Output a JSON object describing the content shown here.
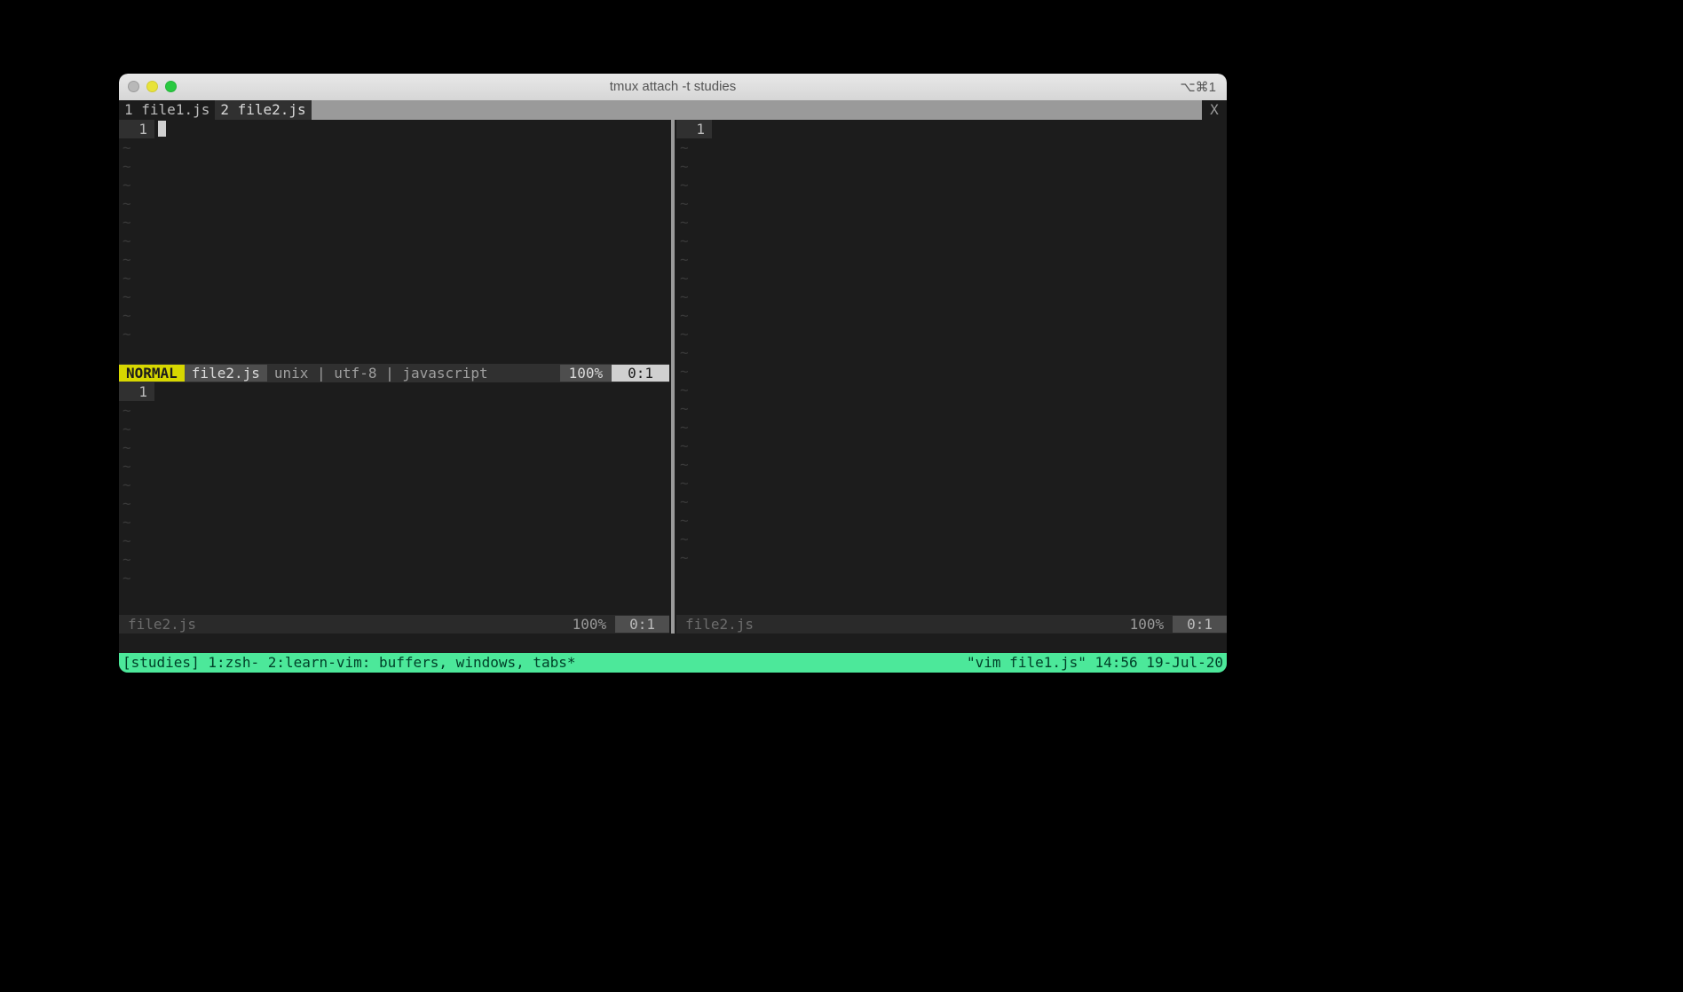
{
  "titlebar": {
    "title": "tmux attach -t studies",
    "shortcut": "⌥⌘1"
  },
  "tabline": {
    "tabs": [
      {
        "index": "1",
        "label": "file1.js",
        "active": false
      },
      {
        "index": "2",
        "label": "file2.js",
        "active": true
      }
    ],
    "close_label": "X"
  },
  "panes": {
    "top_left": {
      "line_number": "1",
      "has_cursor": true,
      "tilde_count": 11,
      "status": {
        "mode": "NORMAL",
        "filename": "file2.js",
        "info": "unix | utf-8 | javascript",
        "percent": "100%",
        "position": "0:1"
      }
    },
    "bottom_left": {
      "line_number": "1",
      "tilde_count": 10,
      "status": {
        "filename": "file2.js",
        "percent": "100%",
        "position": "0:1"
      }
    },
    "right": {
      "line_number": "1",
      "tilde_count": 23,
      "status": {
        "filename": "file2.js",
        "percent": "100%",
        "position": "0:1"
      }
    }
  },
  "tmux": {
    "left": "[studies] 1:zsh- 2:learn-vim: buffers, windows, tabs*",
    "right": "\"vim file1.js\" 14:56 19-Jul-20"
  }
}
